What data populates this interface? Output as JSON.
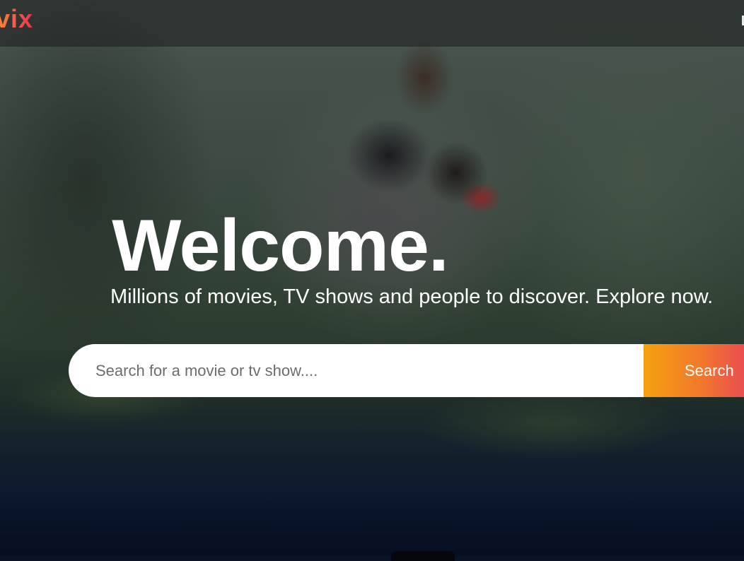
{
  "header": {
    "logo_text": "vix"
  },
  "hero": {
    "title": "Welcome.",
    "subtitle": "Millions of movies, TV shows and people to discover. Explore now."
  },
  "search": {
    "placeholder": "Search for a movie or tv show....",
    "value": "",
    "button_label": "Search"
  },
  "colors": {
    "accent_start": "#f5a10e",
    "accent_end": "#ea4e50",
    "background_dark": "#0a1426"
  }
}
